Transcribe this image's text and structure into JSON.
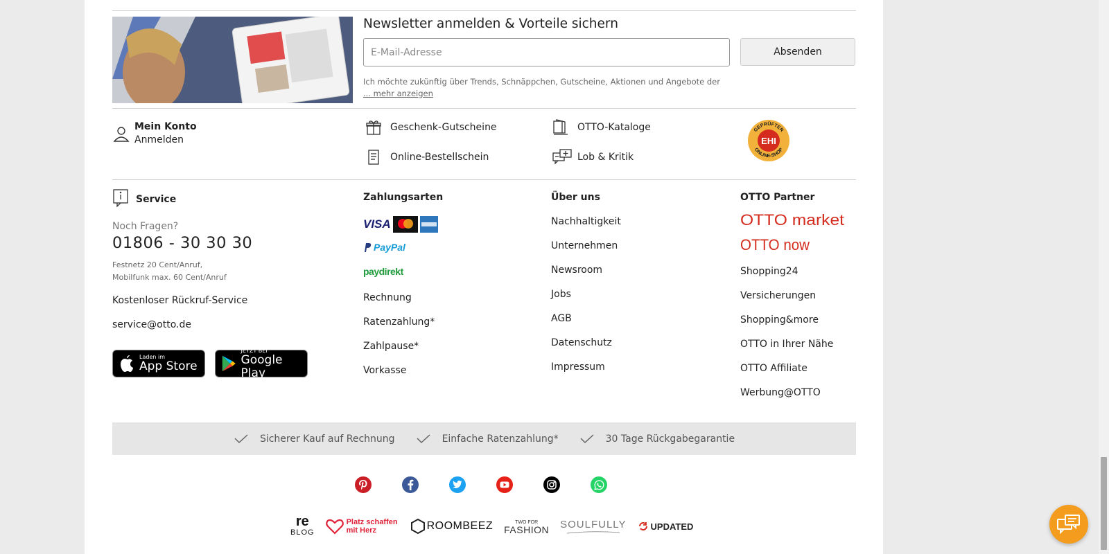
{
  "newsletter": {
    "title": "Newsletter anmelden & Vorteile sichern",
    "email_placeholder": "E-Mail-Adresse",
    "submit_label": "Absenden",
    "consent_text": "Ich möchte zukünftig über Trends, Schnäppchen, Gutscheine, Aktionen und Angebote der",
    "more_label": "... mehr anzeigen"
  },
  "quicklinks": {
    "account_title": "Mein Konto",
    "account_login": "Anmelden",
    "gift_cards": "Geschenk-Gutscheine",
    "order_form": "Online-Bestellschein",
    "catalogs": "OTTO-Kataloge",
    "feedback": "Lob & Kritik",
    "seal_top": "GEPRÜFTER",
    "seal_center": "EHI",
    "seal_bottom": "ONLINE-SHOP"
  },
  "service": {
    "title": "Service",
    "question": "Noch Fragen?",
    "phone": "01806 - 30 30 30",
    "fee_line1": "Festnetz 20 Cent/Anruf,",
    "fee_line2": "Mobilfunk max. 60 Cent/Anruf",
    "callback": "Kostenloser Rückruf-Service",
    "email": "service@otto.de",
    "appstore_small": "Laden im",
    "appstore_large": "App Store",
    "googleplay_small": "JETZT BEI",
    "googleplay_large": "Google Play"
  },
  "payment": {
    "title": "Zahlungsarten",
    "visa": "VISA",
    "paypal": "PayPal",
    "paydirekt": "paydirekt",
    "links": [
      "Rechnung",
      "Ratenzahlung*",
      "Zahlpause*",
      "Vorkasse"
    ]
  },
  "about": {
    "title": "Über uns",
    "links": [
      "Nachhaltigkeit",
      "Unternehmen",
      "Newsroom",
      "Jobs",
      "AGB",
      "Datenschutz",
      "Impressum"
    ]
  },
  "partner": {
    "title": "OTTO Partner",
    "market_logo": "OTTO market",
    "now_logo": "OTTO now",
    "links": [
      "Shopping24",
      "Versicherungen",
      "Shopping&more",
      "OTTO in Ihrer Nähe",
      "OTTO Affiliate",
      "Werbung@OTTO"
    ]
  },
  "usps": [
    "Sicherer Kauf auf Rechnung",
    "Einfache Ratenzahlung*",
    "30 Tage Rückgabegarantie"
  ],
  "social": [
    "pinterest-icon",
    "facebook-icon",
    "twitter-icon",
    "youtube-icon",
    "instagram-icon",
    "whatsapp-icon"
  ],
  "brands": {
    "reblog_top": "re",
    "reblog_bottom": "BLOG",
    "platz": "Platz schaffen mit Herz",
    "roombeez": "ROOMBEEZ",
    "twoforfashion_top": "TWO FOR",
    "twoforfashion_bottom": "FASHION",
    "soulfully": "SOULFULLY",
    "updated": "UPDATED"
  },
  "colors": {
    "otto_red": "#d52b1e",
    "chat_orange": "#f39c1d",
    "usp_bg": "#e6e6e6"
  }
}
